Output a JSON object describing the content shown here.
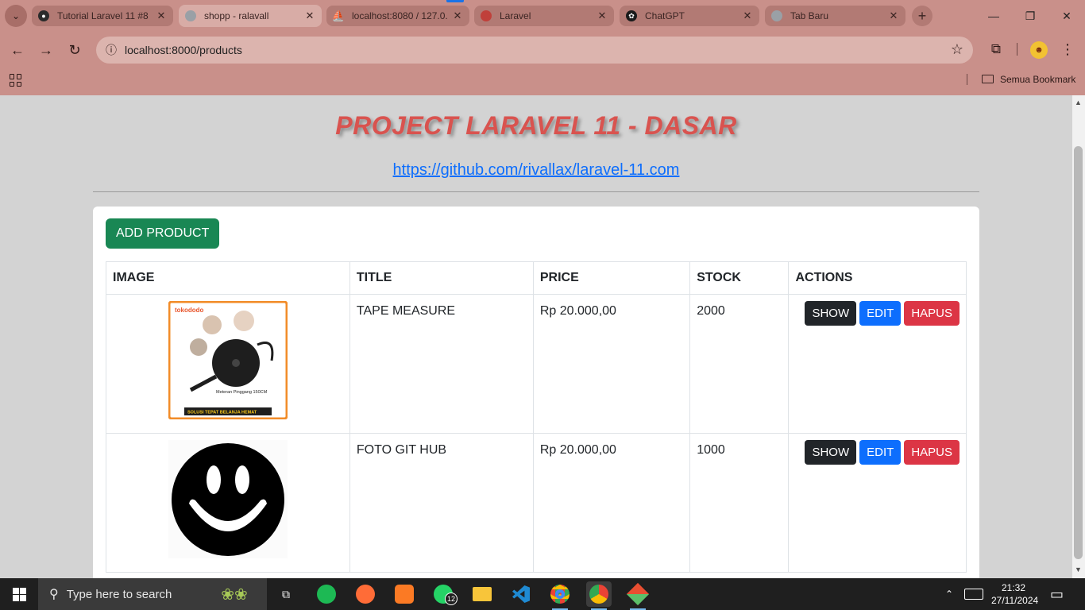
{
  "browser": {
    "tabs": [
      {
        "label": "Tutorial Laravel 11 #8",
        "favicon_color": "#2b2b2b"
      },
      {
        "label": "shopp - ralavall",
        "favicon_color": "#9aa0a6"
      },
      {
        "label": "localhost:8080 / 127.0.",
        "favicon_color": "#f29111"
      },
      {
        "label": "Laravel",
        "favicon_color": "#c0403a"
      },
      {
        "label": "ChatGPT",
        "favicon_color": "#1a1a1a"
      },
      {
        "label": "Tab Baru",
        "favicon_color": "#9aa0a6"
      }
    ],
    "active_tab_index": 1,
    "url": "localhost:8000/products",
    "bookmarks_label": "Semua Bookmark",
    "accent": "#c9908a"
  },
  "page": {
    "title": "PROJECT LARAVEL 11 - DASAR",
    "repo_link": "https://github.com/rivallax/laravel-11.com",
    "add_button": "ADD PRODUCT",
    "columns": [
      "IMAGE",
      "TITLE",
      "PRICE",
      "STOCK",
      "ACTIONS"
    ],
    "products": [
      {
        "title": "TAPE MEASURE",
        "price": "Rp 20.000,00",
        "stock": "2000",
        "image": "tape-measure-product-photo",
        "image_text": {
          "brand": "tokododo",
          "caption": "Meteran Pinggang 150CM",
          "tagline": "SOLUSI TEPAT BELANJA HEMAT"
        }
      },
      {
        "title": "FOTO GIT HUB",
        "price": "Rp 20.000,00",
        "stock": "1000",
        "image": "smiley-face-photo"
      }
    ],
    "actions": {
      "show": "SHOW",
      "edit": "EDIT",
      "hapus": "HAPUS"
    },
    "colors": {
      "title": "#d9534f",
      "link": "#0d6efd",
      "add": "#198754",
      "show": "#212529",
      "edit": "#0d6efd",
      "hapus": "#dc3545"
    }
  },
  "taskbar": {
    "search_placeholder": "Type here to search",
    "apps": [
      "search-highlight-icon",
      "task-view-icon",
      "spotify-icon",
      "postman-icon",
      "xampp-icon",
      "whatsapp-icon",
      "file-explorer-icon",
      "vscode-icon",
      "chrome-icon",
      "chrome-profile-icon",
      "git-icon"
    ],
    "whatsapp_badge": "12",
    "time": "21:32",
    "date": "27/11/2024"
  }
}
